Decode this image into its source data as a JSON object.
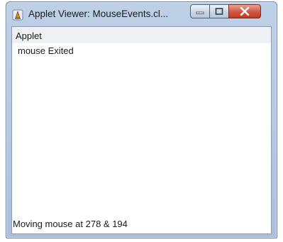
{
  "window": {
    "title": "Applet Viewer: MouseEvents.cl...",
    "icon": "java-applet-icon",
    "controls": {
      "minimize_icon": "minimize-icon",
      "maximize_icon": "maximize-icon",
      "close_icon": "close-icon"
    }
  },
  "menu": {
    "items": [
      {
        "label": "Applet"
      }
    ]
  },
  "applet": {
    "event_message": "mouse Exited",
    "status": "Moving mouse at 278 & 194"
  },
  "colors": {
    "titlebar": "#b4c9e2",
    "close_button": "#c94a33",
    "menubar": "#eef0f3",
    "client_background": "#ffffff"
  }
}
